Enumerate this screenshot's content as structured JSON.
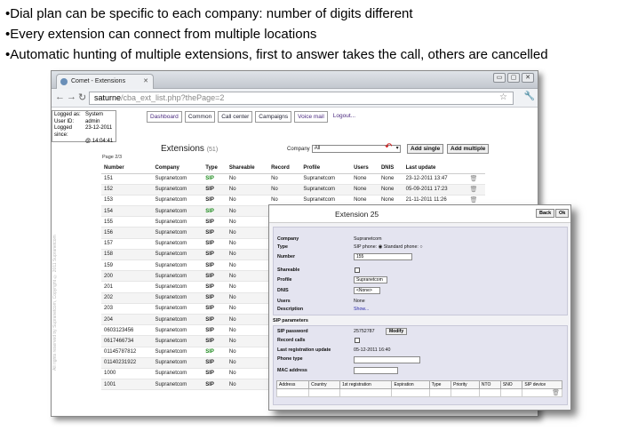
{
  "bullets": [
    "•Dial plan can be specific to each company: number of digits different",
    "•Every extension can connect from multiple locations",
    "•Automatic hunting of multiple extensions, first to answer takes the call, others are cancelled"
  ],
  "browser": {
    "tab_title": "Comet - Extensions",
    "address_host": "saturne",
    "address_path": "/cba_ext_list.php?thePage=2",
    "win_min": "▭",
    "win_max": "▢",
    "win_close": "✕"
  },
  "login": {
    "rows": [
      {
        "k": "Logged as:",
        "v": "System"
      },
      {
        "k": "User ID:",
        "v": "admin"
      },
      {
        "k": "Logged since:",
        "v": "23-12-2011"
      },
      {
        "k": "",
        "v": "@ 14:04:41"
      }
    ]
  },
  "menu": {
    "items": [
      "Dashboard",
      "Common",
      "Call center",
      "Campaigns",
      "Voice mail"
    ],
    "logout": "Logout..."
  },
  "side_text": "All rights reserved by Supranetcom, Copyright © 2011 Supranetcom",
  "list": {
    "title": "Extensions",
    "count": "(51)",
    "company_label": "Company",
    "company_value": "All",
    "add_single": "Add single",
    "add_multiple": "Add multiple",
    "page_info": "Page 2/3",
    "headers": [
      "Number",
      "Company",
      "Type",
      "Shareable",
      "Record",
      "Profile",
      "Users",
      "DNIS",
      "Last update",
      ""
    ],
    "rows": [
      {
        "number": "151",
        "company": "Supranetcom",
        "type": "SIP",
        "green": true,
        "shareable": "No",
        "record": "No",
        "profile": "Supranetcom",
        "users": "None",
        "dnis": "None",
        "updated": "23-12-2011 13:47"
      },
      {
        "number": "152",
        "company": "Supranetcom",
        "type": "SIP",
        "green": false,
        "shareable": "No",
        "record": "No",
        "profile": "Supranetcom",
        "users": "None",
        "dnis": "None",
        "updated": "05-09-2011 17:23"
      },
      {
        "number": "153",
        "company": "Supranetcom",
        "type": "SIP",
        "green": false,
        "shareable": "No",
        "record": "No",
        "profile": "Supranetcom",
        "users": "None",
        "dnis": "None",
        "updated": "21-11-2011 11:26"
      },
      {
        "number": "154",
        "company": "Supranetcom",
        "type": "SIP",
        "green": true,
        "shareable": "No",
        "record": "",
        "profile": "",
        "users": "",
        "dnis": "",
        "updated": ""
      },
      {
        "number": "155",
        "company": "Supranetcom",
        "type": "SIP",
        "green": false,
        "shareable": "No",
        "record": "",
        "profile": "",
        "users": "",
        "dnis": "",
        "updated": ""
      },
      {
        "number": "156",
        "company": "Supranetcom",
        "type": "SIP",
        "green": false,
        "shareable": "No",
        "record": "",
        "profile": "",
        "users": "",
        "dnis": "",
        "updated": ""
      },
      {
        "number": "157",
        "company": "Supranetcom",
        "type": "SIP",
        "green": false,
        "shareable": "No",
        "record": "",
        "profile": "",
        "users": "",
        "dnis": "",
        "updated": ""
      },
      {
        "number": "158",
        "company": "Supranetcom",
        "type": "SIP",
        "green": false,
        "shareable": "No",
        "record": "",
        "profile": "",
        "users": "",
        "dnis": "",
        "updated": ""
      },
      {
        "number": "159",
        "company": "Supranetcom",
        "type": "SIP",
        "green": false,
        "shareable": "No",
        "record": "",
        "profile": "",
        "users": "",
        "dnis": "",
        "updated": ""
      },
      {
        "number": "200",
        "company": "Supranetcom",
        "type": "SIP",
        "green": false,
        "shareable": "No",
        "record": "",
        "profile": "",
        "users": "",
        "dnis": "",
        "updated": ""
      },
      {
        "number": "201",
        "company": "Supranetcom",
        "type": "SIP",
        "green": false,
        "shareable": "No",
        "record": "",
        "profile": "",
        "users": "",
        "dnis": "",
        "updated": ""
      },
      {
        "number": "202",
        "company": "Supranetcom",
        "type": "SIP",
        "green": false,
        "shareable": "No",
        "record": "",
        "profile": "",
        "users": "",
        "dnis": "",
        "updated": ""
      },
      {
        "number": "203",
        "company": "Supranetcom",
        "type": "SIP",
        "green": false,
        "shareable": "No",
        "record": "",
        "profile": "",
        "users": "",
        "dnis": "",
        "updated": ""
      },
      {
        "number": "204",
        "company": "Supranetcom",
        "type": "SIP",
        "green": false,
        "shareable": "No",
        "record": "",
        "profile": "",
        "users": "",
        "dnis": "",
        "updated": ""
      },
      {
        "number": "0603123456",
        "company": "Supranetcom",
        "type": "SIP",
        "green": false,
        "shareable": "No",
        "record": "",
        "profile": "",
        "users": "",
        "dnis": "",
        "updated": ""
      },
      {
        "number": "0617466734",
        "company": "Supranetcom",
        "type": "SIP",
        "green": false,
        "shareable": "No",
        "record": "",
        "profile": "",
        "users": "",
        "dnis": "",
        "updated": ""
      },
      {
        "number": "01145787812",
        "company": "Supranetcom",
        "type": "SIP",
        "green": true,
        "shareable": "No",
        "record": "",
        "profile": "",
        "users": "",
        "dnis": "",
        "updated": ""
      },
      {
        "number": "01140231922",
        "company": "Supranetcom",
        "type": "SIP",
        "green": false,
        "shareable": "No",
        "record": "",
        "profile": "",
        "users": "",
        "dnis": "",
        "updated": ""
      },
      {
        "number": "1000",
        "company": "Supranetcom",
        "type": "SIP",
        "green": false,
        "shareable": "No",
        "record": "",
        "profile": "",
        "users": "",
        "dnis": "",
        "updated": ""
      },
      {
        "number": "1001",
        "company": "Supranetcom",
        "type": "SIP",
        "green": false,
        "shareable": "No",
        "record": "",
        "profile": "",
        "users": "",
        "dnis": "",
        "updated": ""
      }
    ]
  },
  "dialog": {
    "title": "Extension 25",
    "back": "Back",
    "ok": "Ok",
    "company_label": "Company",
    "company_value": "Supranetcom",
    "type_label": "Type",
    "sip_phone": "SIP phone:",
    "standard_phone": "Standard phone:",
    "number_label": "Number",
    "number_value": "155",
    "shareable_label": "Shareable",
    "profile_label": "Profile",
    "profile_value": "Supranetcom",
    "dnis_label": "DNIS",
    "dnis_value": "<None>",
    "users_label": "Users",
    "users_value": "None",
    "description_label": "Description",
    "description_value": "Show...",
    "sip_section": "SIP parameters",
    "sip_password_label": "SIP password",
    "sip_password_value": "25752787",
    "modify": "Modify",
    "record_label": "Record calls",
    "last_reg_label": "Last registration update",
    "last_reg_value": "05-12-2011 16:40",
    "phone_type_label": "Phone type",
    "mac_label": "MAC address",
    "sub_headers": [
      "Address",
      "Country",
      "1st registration",
      "Expiration",
      "Type",
      "Priority",
      "NTO",
      "SNO",
      "SIP device"
    ]
  }
}
